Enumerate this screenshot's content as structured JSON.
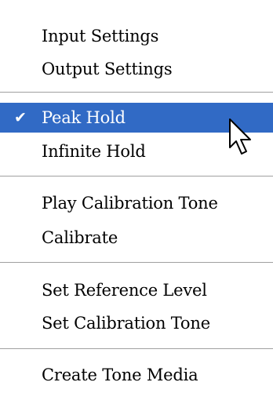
{
  "menu": {
    "items": [
      {
        "label": "Input Settings"
      },
      {
        "label": "Output Settings"
      },
      {
        "label": "Peak Hold",
        "checked": true,
        "highlighted": true
      },
      {
        "label": "Infinite Hold"
      },
      {
        "label": "Play Calibration Tone"
      },
      {
        "label": "Calibrate"
      },
      {
        "label": "Set Reference Level"
      },
      {
        "label": "Set Calibration Tone"
      },
      {
        "label": "Create Tone Media"
      }
    ],
    "check_glyph": "✔",
    "highlight_color": "#316ac5",
    "separator_color": "#a0a0a0"
  },
  "icons": {
    "cursor": "arrow-pointer-icon",
    "check": "checkmark-icon"
  }
}
